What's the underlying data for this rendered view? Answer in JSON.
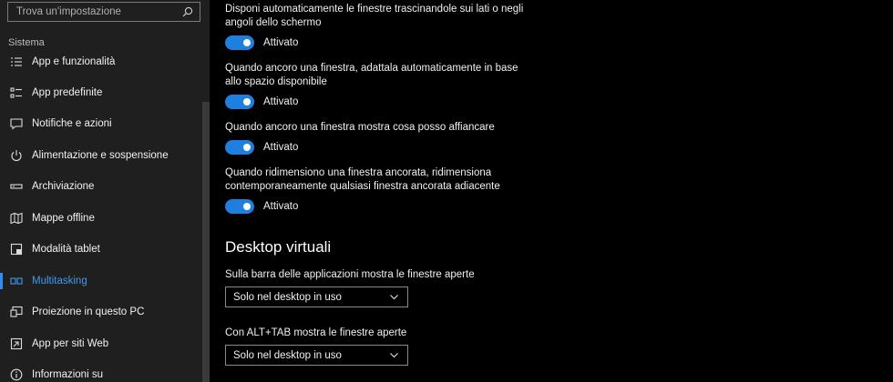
{
  "search": {
    "placeholder": "Trova un'impostazione"
  },
  "sidebar": {
    "section_title": "Sistema",
    "items": [
      {
        "label": "App e funzionalità",
        "icon": "list-icon"
      },
      {
        "label": "App predefinite",
        "icon": "app-list-icon"
      },
      {
        "label": "Notifiche e azioni",
        "icon": "message-icon"
      },
      {
        "label": "Alimentazione e sospensione",
        "icon": "power-icon"
      },
      {
        "label": "Archiviazione",
        "icon": "storage-icon"
      },
      {
        "label": "Mappe offline",
        "icon": "map-icon"
      },
      {
        "label": "Modalità tablet",
        "icon": "tablet-icon"
      },
      {
        "label": "Multitasking",
        "icon": "multitasking-icon",
        "selected": true
      },
      {
        "label": "Proiezione in questo PC",
        "icon": "projection-icon"
      },
      {
        "label": "App per siti Web",
        "icon": "web-app-icon"
      },
      {
        "label": "Informazioni su",
        "icon": "info-icon"
      }
    ]
  },
  "snap": {
    "settings": [
      {
        "text": "Disponi automaticamente le finestre trascinandole sui lati o negli angoli dello schermo",
        "state": "Attivato"
      },
      {
        "text": "Quando ancoro una finestra, adattala automaticamente in base allo spazio disponibile",
        "state": "Attivato"
      },
      {
        "text": "Quando ancoro una finestra mostra cosa posso affiancare",
        "state": "Attivato"
      },
      {
        "text": "Quando ridimensiono una finestra ancorata, ridimensiona contemporaneamente qualsiasi finestra ancorata adiacente",
        "state": "Attivato"
      }
    ]
  },
  "virtual_desktops": {
    "heading": "Desktop virtuali",
    "taskbar_label": "Sulla barra delle applicazioni mostra le finestre aperte",
    "taskbar_value": "Solo nel desktop in uso",
    "alttab_label": "Con ALT+TAB mostra le finestre aperte",
    "alttab_value": "Solo nel desktop in uso"
  },
  "colors": {
    "accent": "#1e7fdf",
    "sidebar_bg": "#1f1f1f",
    "main_bg": "#000000",
    "selected_text": "#3e9bf0"
  }
}
